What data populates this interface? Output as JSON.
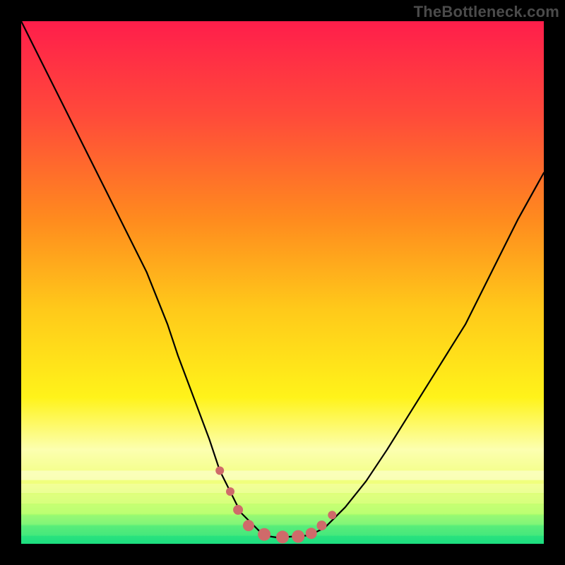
{
  "watermark": "TheBottleneck.com",
  "chart_data": {
    "type": "line",
    "title": "",
    "xlabel": "",
    "ylabel": "",
    "xlim": [
      0,
      100
    ],
    "ylim": [
      0,
      100
    ],
    "grid": false,
    "legend": false,
    "gradient_stops": [
      {
        "offset": 0.0,
        "color": "#ff1e4b"
      },
      {
        "offset": 0.18,
        "color": "#ff4a3a"
      },
      {
        "offset": 0.38,
        "color": "#ff8b1e"
      },
      {
        "offset": 0.55,
        "color": "#ffc91a"
      },
      {
        "offset": 0.72,
        "color": "#fff31a"
      },
      {
        "offset": 0.82,
        "color": "#fcffb0"
      },
      {
        "offset": 0.885,
        "color": "#f0ff7a"
      },
      {
        "offset": 0.94,
        "color": "#b4ff6a"
      },
      {
        "offset": 0.97,
        "color": "#5cf07a"
      },
      {
        "offset": 1.0,
        "color": "#18e07f"
      }
    ],
    "series": [
      {
        "name": "bottleneck-curve",
        "stroke": "#000000",
        "stroke_width": 2.2,
        "x": [
          0,
          4,
          8,
          12,
          16,
          20,
          24,
          28,
          30,
          33,
          36,
          38,
          40,
          42,
          44,
          46,
          47,
          49,
          55,
          58,
          62,
          66,
          70,
          75,
          80,
          85,
          90,
          95,
          100
        ],
        "y": [
          100,
          92,
          84,
          76,
          68,
          60,
          52,
          42,
          36,
          28,
          20,
          14,
          10,
          6,
          4,
          2,
          1.5,
          1.2,
          1.6,
          3,
          7,
          12,
          18,
          26,
          34,
          42,
          52,
          62,
          71
        ]
      }
    ],
    "markers": {
      "name": "highlight-dots",
      "color": "#cf6a6a",
      "radius_min": 5,
      "radius_max": 9,
      "points": [
        {
          "x": 38.0,
          "y": 14.0,
          "r": 6
        },
        {
          "x": 40.0,
          "y": 10.0,
          "r": 6
        },
        {
          "x": 41.5,
          "y": 6.5,
          "r": 7
        },
        {
          "x": 43.5,
          "y": 3.5,
          "r": 8
        },
        {
          "x": 46.5,
          "y": 1.8,
          "r": 9
        },
        {
          "x": 50.0,
          "y": 1.3,
          "r": 9
        },
        {
          "x": 53.0,
          "y": 1.4,
          "r": 9
        },
        {
          "x": 55.5,
          "y": 2.0,
          "r": 8
        },
        {
          "x": 57.5,
          "y": 3.5,
          "r": 7
        },
        {
          "x": 59.5,
          "y": 5.5,
          "r": 6
        }
      ]
    }
  }
}
